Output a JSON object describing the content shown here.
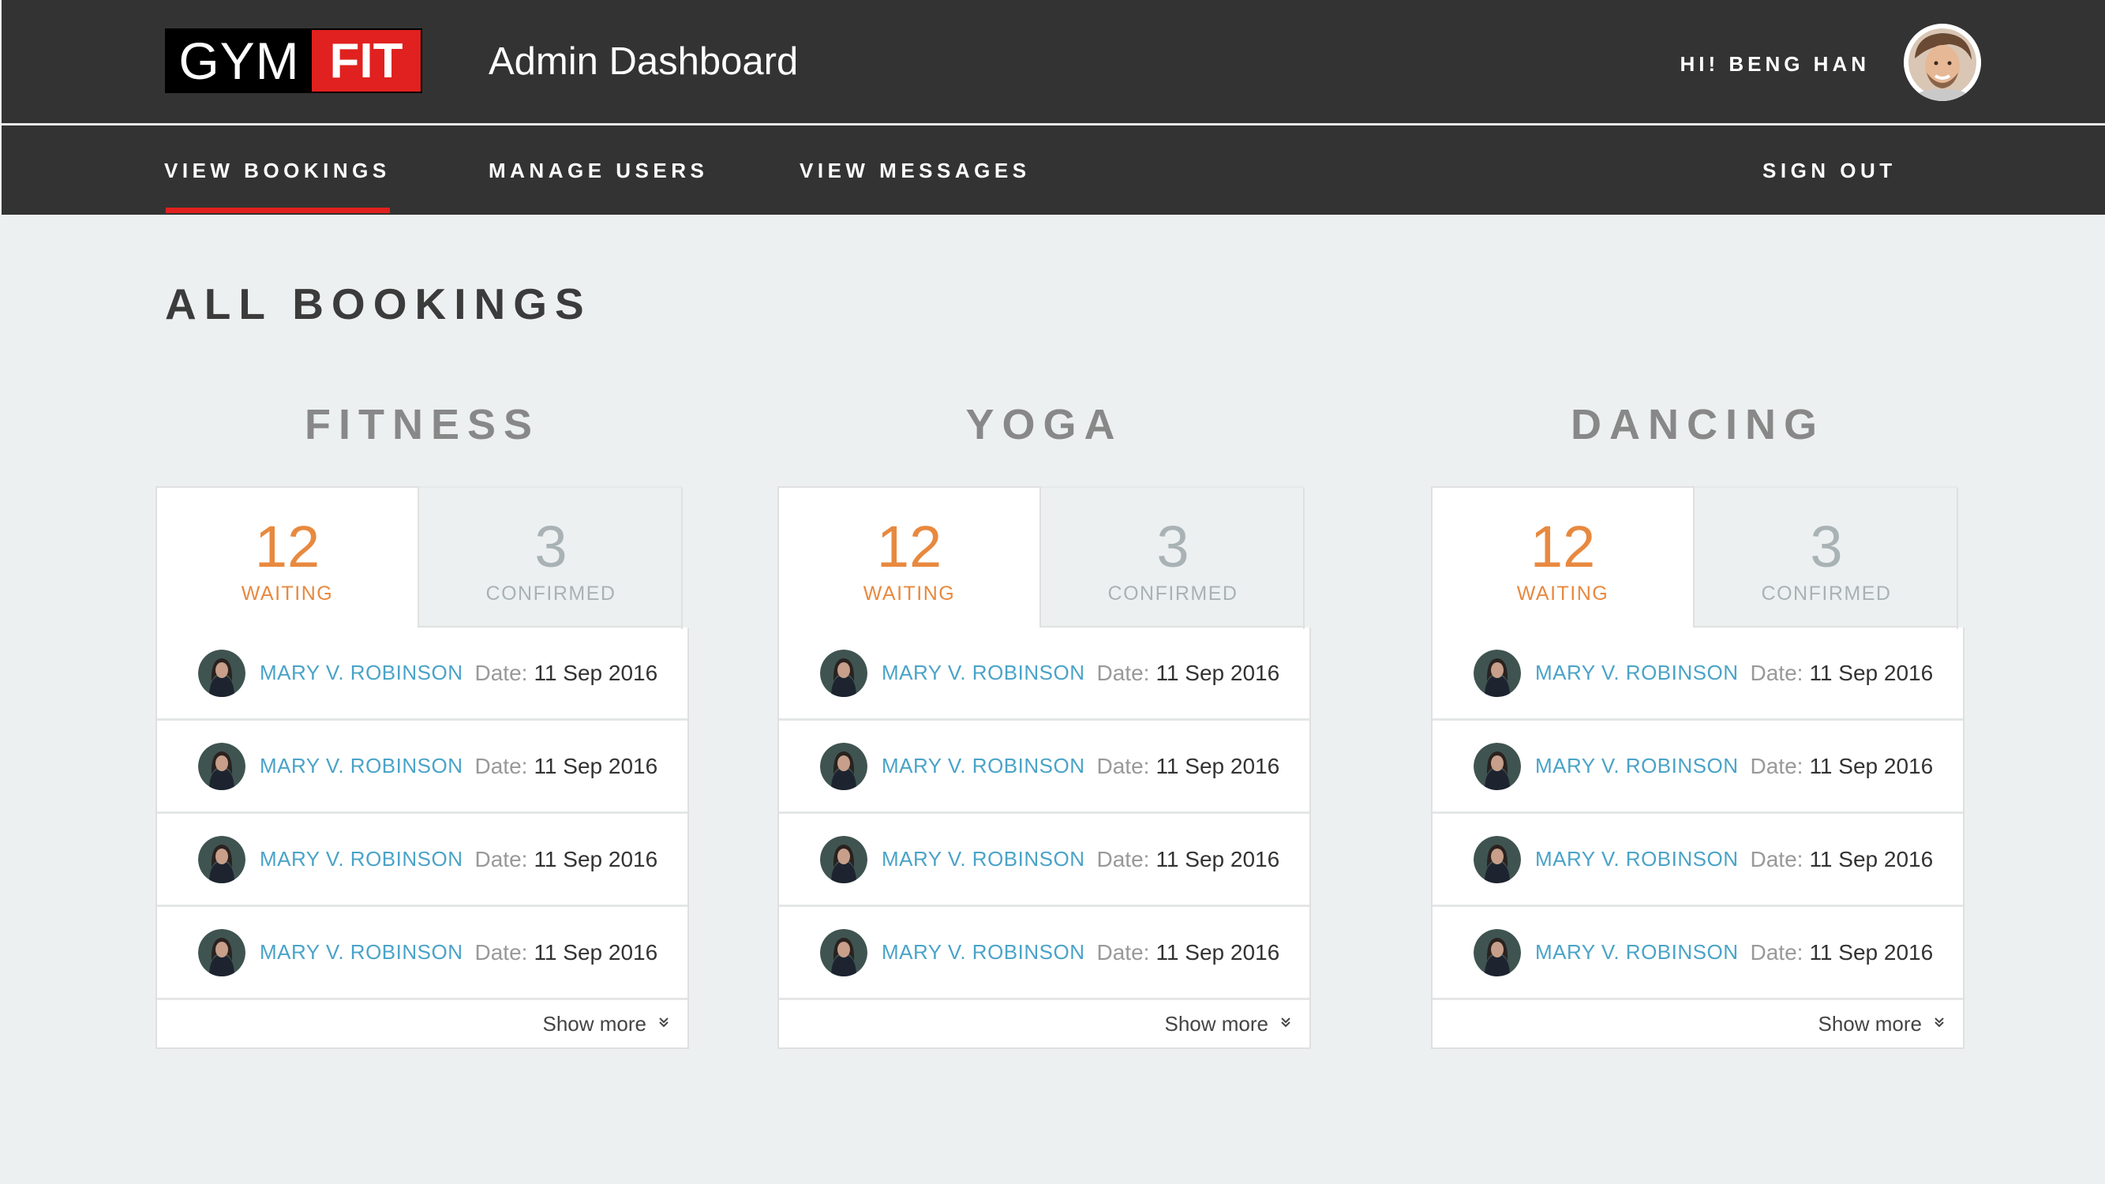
{
  "header": {
    "logo_left": "GYM",
    "logo_right": "FIT",
    "title": "Admin Dashboard",
    "greeting": "HI! BENG HAN"
  },
  "nav": {
    "items": [
      "VIEW BOOKINGS",
      "MANAGE USERS",
      "VIEW MESSAGES"
    ],
    "active": "VIEW BOOKINGS",
    "sign_out": "SIGN OUT"
  },
  "page": {
    "title": "ALL BOOKINGS"
  },
  "columns": [
    {
      "title": "FITNESS",
      "tabs": [
        {
          "count": "12",
          "label": "WAITING"
        },
        {
          "count": "3",
          "label": "CONFIRMED"
        }
      ],
      "bookings": [
        {
          "name": "MARY V. ROBINSON",
          "date_label": "Date:",
          "date": "11 Sep 2016"
        },
        {
          "name": "MARY V. ROBINSON",
          "date_label": "Date:",
          "date": "11 Sep 2016"
        },
        {
          "name": "MARY V. ROBINSON",
          "date_label": "Date:",
          "date": "11 Sep 2016"
        },
        {
          "name": "MARY V. ROBINSON",
          "date_label": "Date:",
          "date": "11 Sep 2016"
        }
      ],
      "show_more": "Show more"
    },
    {
      "title": "YOGA",
      "tabs": [
        {
          "count": "12",
          "label": "WAITING"
        },
        {
          "count": "3",
          "label": "CONFIRMED"
        }
      ],
      "bookings": [
        {
          "name": "MARY V. ROBINSON",
          "date_label": "Date:",
          "date": "11 Sep 2016"
        },
        {
          "name": "MARY V. ROBINSON",
          "date_label": "Date:",
          "date": "11 Sep 2016"
        },
        {
          "name": "MARY V. ROBINSON",
          "date_label": "Date:",
          "date": "11 Sep 2016"
        },
        {
          "name": "MARY V. ROBINSON",
          "date_label": "Date:",
          "date": "11 Sep 2016"
        }
      ],
      "show_more": "Show more"
    },
    {
      "title": "DANCING",
      "tabs": [
        {
          "count": "12",
          "label": "WAITING"
        },
        {
          "count": "3",
          "label": "CONFIRMED"
        }
      ],
      "bookings": [
        {
          "name": "MARY V. ROBINSON",
          "date_label": "Date:",
          "date": "11 Sep 2016"
        },
        {
          "name": "MARY V. ROBINSON",
          "date_label": "Date:",
          "date": "11 Sep 2016"
        },
        {
          "name": "MARY V. ROBINSON",
          "date_label": "Date:",
          "date": "11 Sep 2016"
        },
        {
          "name": "MARY V. ROBINSON",
          "date_label": "Date:",
          "date": "11 Sep 2016"
        }
      ],
      "show_more": "Show more"
    }
  ],
  "colors": {
    "accent_red": "#e0211f",
    "waiting_orange": "#e8893f",
    "name_blue": "#4aa3c8",
    "header_bg": "#333333"
  },
  "icons": {
    "avatar": "user-avatar-photo",
    "show_more": "double-chevron-down-icon"
  }
}
